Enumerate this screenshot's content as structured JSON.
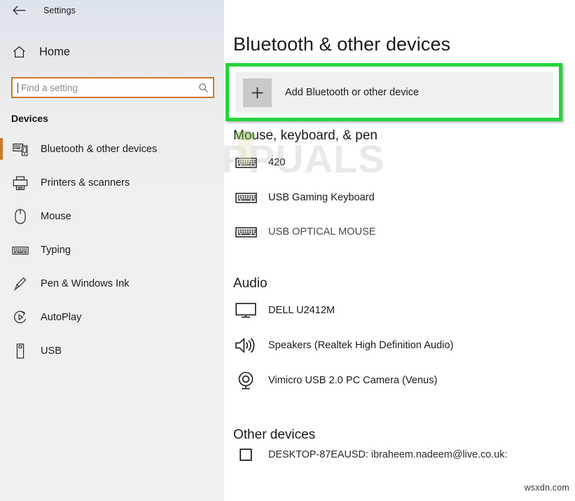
{
  "window": {
    "title": "Settings",
    "back_icon": "back-arrow-icon"
  },
  "sidebar": {
    "home": {
      "label": "Home",
      "icon": "home-icon"
    },
    "search": {
      "value": "",
      "placeholder": "Find a setting",
      "icon": "search-icon"
    },
    "group_title": "Devices",
    "accent_color": "#c87a2a",
    "items": [
      {
        "label": "Bluetooth & other devices",
        "icon": "bluetooth-devices-icon",
        "selected": true
      },
      {
        "label": "Printers & scanners",
        "icon": "printer-icon",
        "selected": false
      },
      {
        "label": "Mouse",
        "icon": "mouse-icon",
        "selected": false
      },
      {
        "label": "Typing",
        "icon": "keyboard-icon",
        "selected": false
      },
      {
        "label": "Pen & Windows Ink",
        "icon": "pen-icon",
        "selected": false
      },
      {
        "label": "AutoPlay",
        "icon": "autoplay-icon",
        "selected": false
      },
      {
        "label": "USB",
        "icon": "usb-icon",
        "selected": false
      }
    ]
  },
  "main": {
    "page_title": "Bluetooth & other devices",
    "add_device": {
      "label": "Add Bluetooth or other device",
      "icon": "plus-icon",
      "highlight_color": "#22d63a"
    },
    "sections": [
      {
        "heading": "Mouse, keyboard, & pen",
        "devices": [
          {
            "name": "420",
            "icon": "keyboard-icon"
          },
          {
            "name": "USB Gaming Keyboard",
            "icon": "keyboard-icon"
          },
          {
            "name": "USB OPTICAL MOUSE",
            "icon": "keyboard-icon"
          }
        ]
      },
      {
        "heading": "Audio",
        "devices": [
          {
            "name": "DELL U2412M",
            "icon": "monitor-icon"
          },
          {
            "name": "Speakers (Realtek High Definition Audio)",
            "icon": "speaker-icon"
          },
          {
            "name": "Vimicro USB 2.0 PC Camera (Venus)",
            "icon": "camera-icon"
          }
        ]
      },
      {
        "heading": "Other devices",
        "devices": [
          {
            "name": "DESKTOP-87EAUSD: ibraheem.nadeem@live.co.uk:",
            "icon": "square-device-icon"
          }
        ]
      }
    ]
  },
  "watermarks": {
    "appuals": "APPUALS",
    "wsxdn": "wsxdn.com"
  }
}
